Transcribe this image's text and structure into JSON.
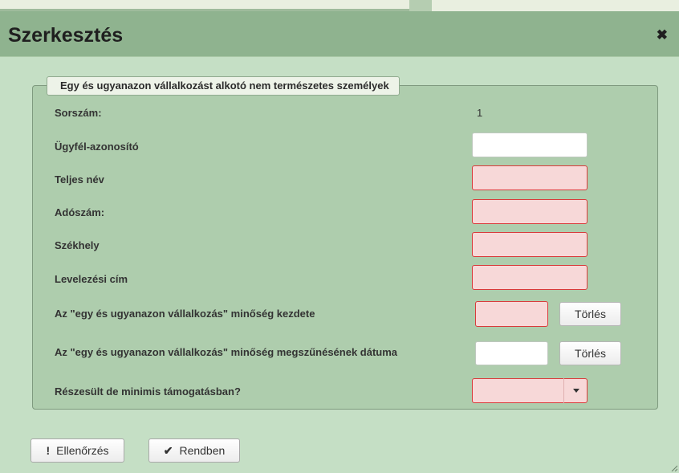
{
  "dialog": {
    "title": "Szerkesztés",
    "close_icon": "✖"
  },
  "group": {
    "legend": "Egy és ugyanazon vállalkozást alkotó nem természetes személyek"
  },
  "fields": {
    "sorszam": {
      "label": "Sorszám:",
      "value": "1"
    },
    "ugyfel_azonosito": {
      "label": "Ügyfél-azonosító",
      "value": ""
    },
    "teljes_nev": {
      "label": "Teljes név",
      "value": ""
    },
    "adoszam": {
      "label": "Adószám:",
      "value": ""
    },
    "szekhely": {
      "label": "Székhely",
      "value": ""
    },
    "levelezesi_cim": {
      "label": "Levelezési cím",
      "value": ""
    },
    "minoseg_kezdete": {
      "label": "Az \"egy és ugyanazon vállalkozás\" minőség kezdete",
      "value": "",
      "clear_label": "Törlés"
    },
    "minoseg_megszunese": {
      "label": "Az \"egy és ugyanazon vállalkozás\" minőség megszűnésének dátuma",
      "value": "",
      "clear_label": "Törlés"
    },
    "de_minimis": {
      "label": "Részesült de minimis támogatásban?",
      "selected": ""
    }
  },
  "footer": {
    "check_icon_glyph": "!",
    "check_label": "Ellenőrzés",
    "ok_icon_glyph": "✔",
    "ok_label": "Rendben"
  },
  "colors": {
    "titlebar": "#8fb38f",
    "panel": "#aecdad",
    "required_fill": "#f7d8d8",
    "required_border": "#d93b3b"
  }
}
